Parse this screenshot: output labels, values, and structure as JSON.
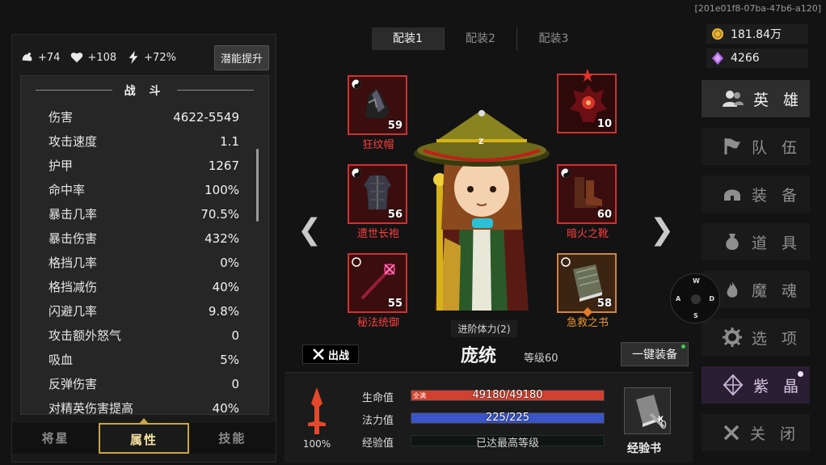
{
  "session_id": "[201e01f8-07ba-47b6-a120]",
  "bonuses": [
    {
      "icon": "strength-icon",
      "value": "+74"
    },
    {
      "icon": "heart-icon",
      "value": "+108"
    },
    {
      "icon": "lightning-icon",
      "value": "+72%"
    }
  ],
  "potential_button": "潜能提升",
  "stats_section_title": "战 斗",
  "stats": [
    {
      "label": "伤害",
      "value": "4622-5549"
    },
    {
      "label": "攻击速度",
      "value": "1.1"
    },
    {
      "label": "护甲",
      "value": "1267"
    },
    {
      "label": "命中率",
      "value": "100%"
    },
    {
      "label": "暴击几率",
      "value": "70.5%"
    },
    {
      "label": "暴击伤害",
      "value": "432%"
    },
    {
      "label": "格挡几率",
      "value": "0%"
    },
    {
      "label": "格挡减伤",
      "value": "40%"
    },
    {
      "label": "闪避几率",
      "value": "9.8%"
    },
    {
      "label": "攻击额外怒气",
      "value": "0"
    },
    {
      "label": "吸血",
      "value": "5%"
    },
    {
      "label": "反弹伤害",
      "value": "0"
    },
    {
      "label": "对精英伤害提高",
      "value": "40%"
    }
  ],
  "bottom_tabs": [
    "将星",
    "属性",
    "技能"
  ],
  "loadout_tabs": [
    "配装1",
    "配装2",
    "配装3"
  ],
  "slots": {
    "hat": {
      "name": "狂纹帽",
      "level": "59"
    },
    "robe": {
      "name": "遗世长袍",
      "level": "56"
    },
    "weapon": {
      "name": "秘法统御",
      "level": "55"
    },
    "artifact": {
      "level": "10"
    },
    "boots": {
      "name": "暗火之靴",
      "level": "60"
    },
    "book": {
      "name": "急救之书",
      "level": "58"
    }
  },
  "hero_mark": "Z",
  "advance_label": "进阶体力(2)",
  "battle_button": "出战",
  "hero_name": "庞统",
  "hero_level": "等级60",
  "equip_all_button": "一键装备",
  "potion_percent": "100%",
  "bars": {
    "hp_label": "生命值",
    "hp_text": "49180/49180",
    "hp_tag": "全满",
    "mp_label": "法力值",
    "mp_text": "225/225",
    "exp_label": "经验值",
    "exp_text": "已达最高等级"
  },
  "exp_book": {
    "count": "0",
    "label": "经验书",
    "mark": "X"
  },
  "currency": {
    "gold": "181.84万",
    "gems": "4266"
  },
  "nav": [
    "英 雄",
    "队 伍",
    "装 备",
    "道 具",
    "魔 魂",
    "选 项",
    "紫 晶",
    "关 闭"
  ],
  "compass": {
    "n": "W",
    "w": "A",
    "e": "D",
    "s": "S"
  },
  "colors": {
    "hp": "#d0412f",
    "mp": "#3a55c8",
    "gold": "#e7b43a",
    "gem": "#b064e8",
    "rare_border": "#d23030",
    "epic_border": "#d2853a"
  }
}
